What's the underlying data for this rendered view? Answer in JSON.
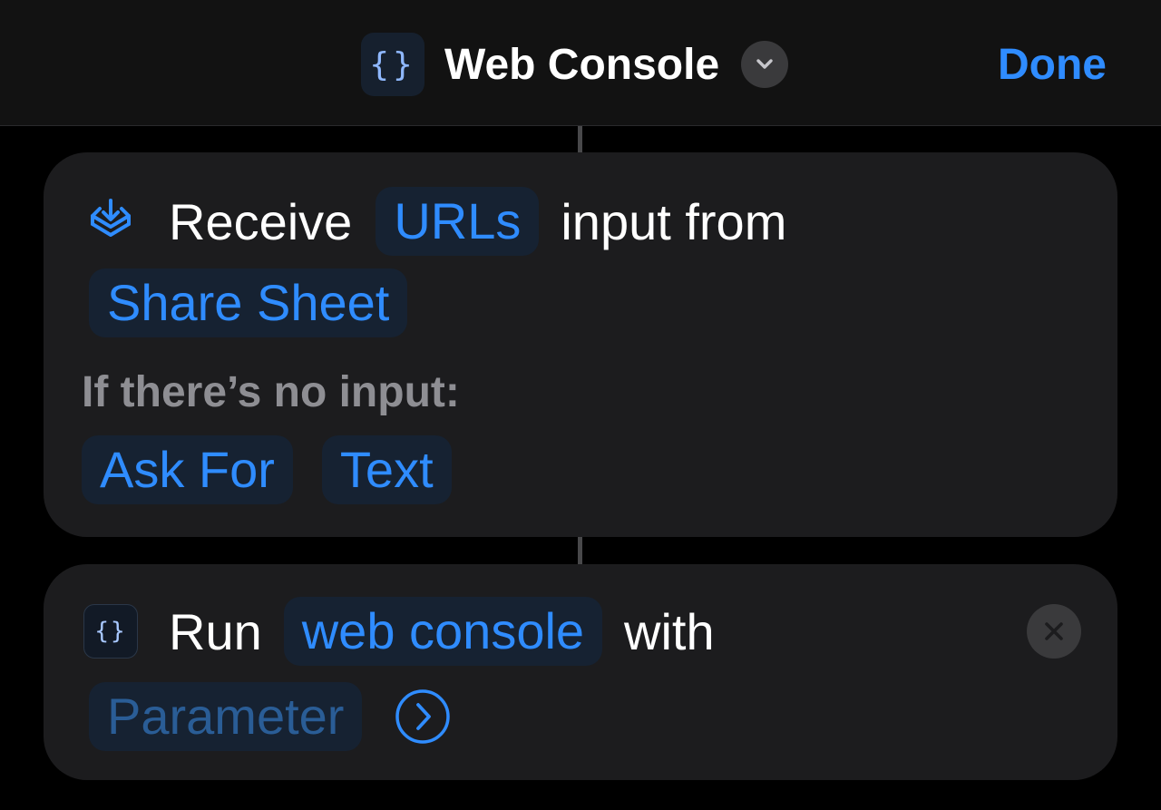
{
  "header": {
    "app_icon_glyph": "{}",
    "title": "Web Console",
    "done_label": "Done"
  },
  "receive_action": {
    "verb": "Receive",
    "type_token": "URLs",
    "middle_text": "input from",
    "source_token": "Share Sheet",
    "fallback_label": "If there’s no input:",
    "fallback_action_token": "Ask For",
    "fallback_type_token": "Text"
  },
  "run_action": {
    "icon_glyph": "{}",
    "verb": "Run",
    "shortcut_token": "web console",
    "connector_text": "with",
    "parameter_placeholder": "Parameter"
  },
  "colors": {
    "accent": "#2f8cff",
    "background": "#000000",
    "card": "#1c1c1e",
    "token_bg": "#162232",
    "subtle_text": "#8e8e93"
  },
  "icons": {
    "app": "curly-braces-icon",
    "title_chevron": "chevron-down-icon",
    "receive": "tray-download-icon",
    "run": "curly-braces-icon",
    "close": "close-icon",
    "arrow": "chevron-right-circle-icon"
  }
}
